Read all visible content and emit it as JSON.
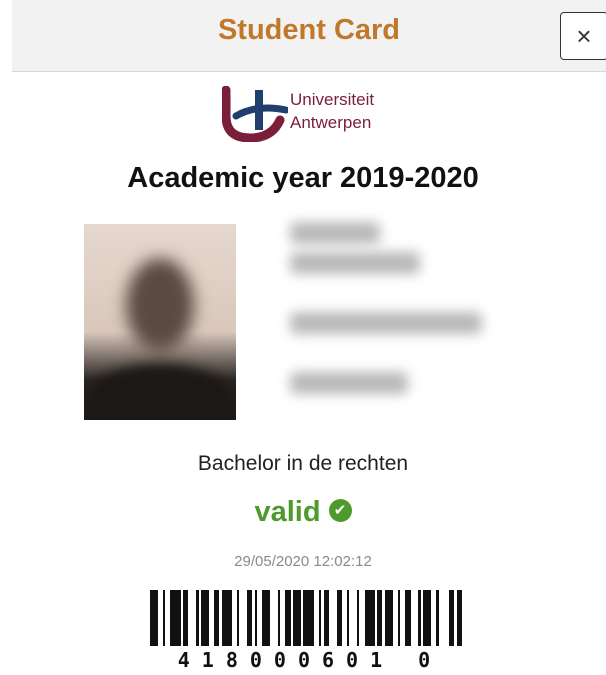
{
  "header": {
    "title": "Student Card",
    "close_label": "×"
  },
  "logo": {
    "line1": "Universiteit",
    "line2": "Antwerpen"
  },
  "card": {
    "academic_year": "Academic year 2019-2020",
    "program": "Bachelor in de rechten",
    "status": "valid",
    "timestamp": "29/05/2020 12:02:12",
    "barcode_number": "418000601 0"
  },
  "colors": {
    "title": "#c0792b",
    "valid": "#4f9a2c",
    "logo_red": "#7a1e3a",
    "logo_blue": "#1f3f6e"
  }
}
